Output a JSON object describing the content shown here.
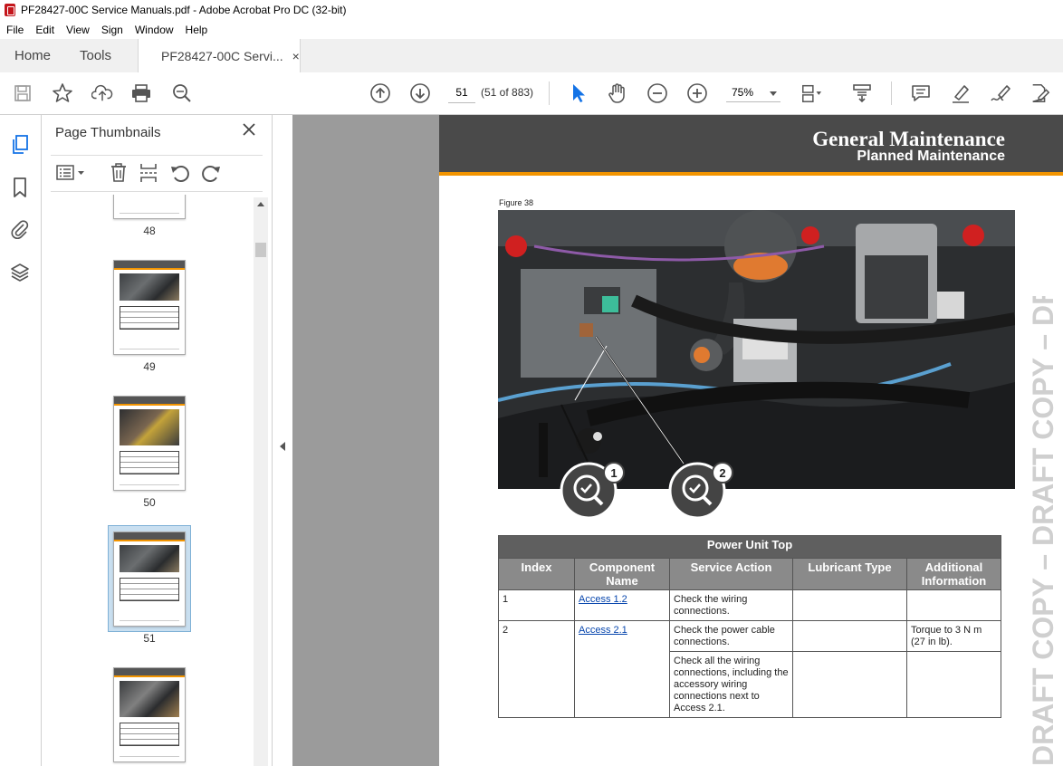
{
  "window": {
    "title": "PF28427-00C Service Manuals.pdf - Adobe Acrobat Pro DC (32-bit)"
  },
  "menu": [
    "File",
    "Edit",
    "View",
    "Sign",
    "Window",
    "Help"
  ],
  "tabs": {
    "home": "Home",
    "tools": "Tools",
    "document": "PF28427-00C Servi...",
    "close": "×"
  },
  "toolbar": {
    "page_number": "51",
    "page_count": "(51 of 883)",
    "zoom": "75%"
  },
  "panel": {
    "title": "Page Thumbnails",
    "thumbnails": [
      {
        "label": "48"
      },
      {
        "label": "49"
      },
      {
        "label": "50"
      },
      {
        "label": "51",
        "selected": true
      },
      {
        "label": ""
      }
    ]
  },
  "document": {
    "header_title": "General Maintenance",
    "header_subtitle": "Planned Maintenance",
    "figure_label": "Figure 38",
    "callouts": [
      "1",
      "2"
    ],
    "watermark": "DRAFT COPY – DRAFT COPY – DRAFT COPY",
    "table": {
      "caption": "Power Unit Top",
      "columns": [
        "Index",
        "Component Name",
        "Service Action",
        "Lubricant Type",
        "Additional Information"
      ],
      "rows": [
        {
          "index": "1",
          "component": "Access 1.2",
          "action": "Check the wiring connections.",
          "lubricant": "",
          "info": ""
        },
        {
          "index": "2",
          "component": "Access 2.1",
          "action": "Check the power cable connections.",
          "lubricant": "",
          "info": "Torque to 3 N m (27 in lb)."
        },
        {
          "index": "",
          "component": "",
          "action": "Check all the wiring connections, including the accessory wiring connections next to Access 2.1.",
          "lubricant": "",
          "info": ""
        }
      ]
    }
  },
  "colors": {
    "accent_orange": "#f29400",
    "header_gray": "#4a4a4a",
    "link_blue": "#0645ad"
  }
}
